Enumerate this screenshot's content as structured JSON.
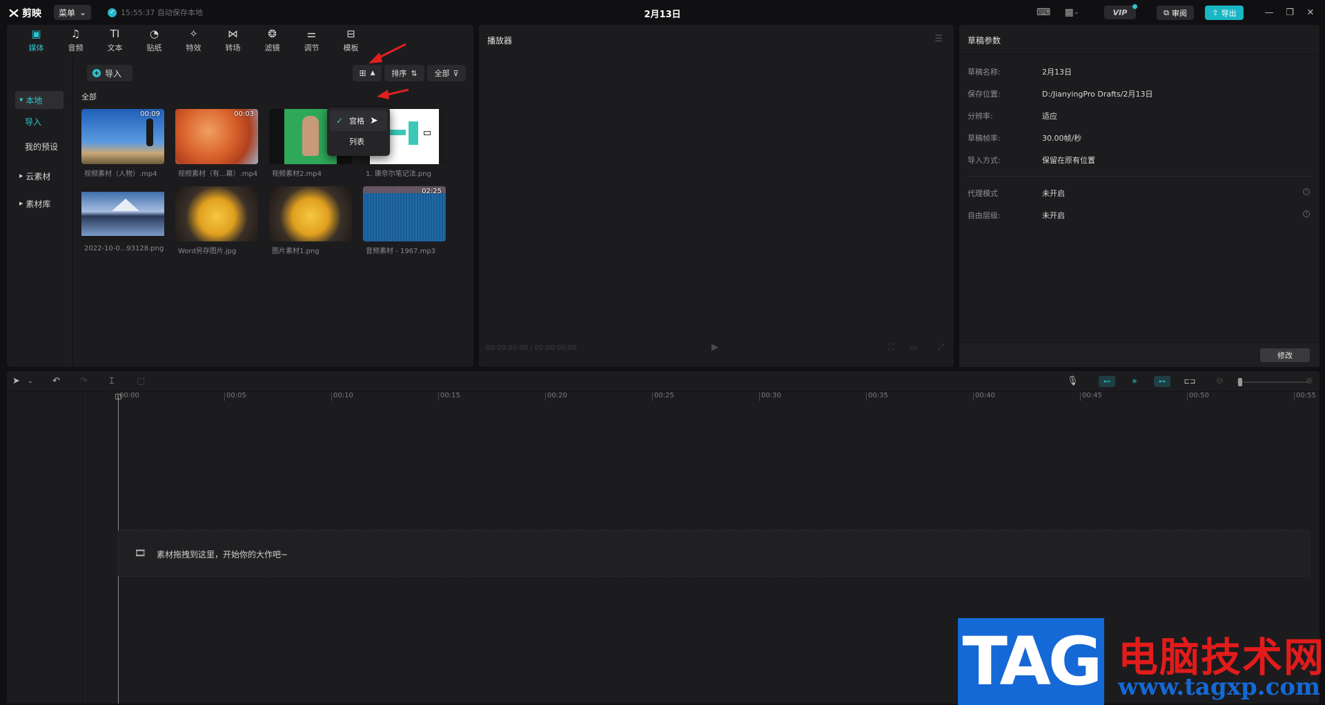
{
  "titlebar": {
    "app_name": "剪映",
    "menu_label": "菜单",
    "autosave_text": "15:55:37 自动保存本地",
    "doc_title": "2月13日",
    "vip_label": "VIP",
    "review_label": "审阅",
    "export_label": "导出"
  },
  "media": {
    "tabs": [
      {
        "label": "媒体",
        "icon": "▣"
      },
      {
        "label": "音频",
        "icon": "♫"
      },
      {
        "label": "文本",
        "icon": "TI"
      },
      {
        "label": "贴纸",
        "icon": "◔"
      },
      {
        "label": "特效",
        "icon": "✧"
      },
      {
        "label": "转场",
        "icon": "⋈"
      },
      {
        "label": "滤镜",
        "icon": "❂"
      },
      {
        "label": "调节",
        "icon": "⚌"
      },
      {
        "label": "模板",
        "icon": "⊟"
      }
    ],
    "sidebar": {
      "local": "本地",
      "import": "导入",
      "my_presets": "我的预设",
      "cloud": "云素材",
      "library": "素材库"
    },
    "import_label": "导入",
    "sort_label": "排序",
    "filter_label": "全部",
    "all_label": "全部",
    "view_menu": [
      {
        "label": "宫格",
        "selected": true
      },
      {
        "label": "列表",
        "selected": false
      }
    ],
    "items": [
      {
        "caption": "视频素材（人物）.mp4",
        "duration": "00:09"
      },
      {
        "caption": "视频素材（有...幕）.mp4",
        "duration": "00:03"
      },
      {
        "caption": "视频素材2.mp4",
        "duration": ""
      },
      {
        "caption": "1. 康奈尔笔记法.png",
        "duration": ""
      },
      {
        "caption": "2022-10-0...93128.png",
        "duration": ""
      },
      {
        "caption": "Word另存图片.jpg",
        "duration": ""
      },
      {
        "caption": "图片素材1.png",
        "duration": ""
      },
      {
        "caption": "音频素材 - 1967.mp3",
        "duration": "02:25"
      }
    ]
  },
  "player": {
    "title": "播放器",
    "time": "00:00:00:00 / 00:00:00:00"
  },
  "params": {
    "title": "草稿参数",
    "rows": [
      {
        "key": "草稿名称:",
        "value": "2月13日"
      },
      {
        "key": "保存位置:",
        "value": "D:/JianyingPro Drafts/2月13日"
      },
      {
        "key": "分辨率:",
        "value": "适应"
      },
      {
        "key": "草稿帧率:",
        "value": "30.00帧/秒"
      },
      {
        "key": "导入方式:",
        "value": "保留在原有位置"
      },
      {
        "key": "代理模式",
        "value": "未开启"
      },
      {
        "key": "自由层级:",
        "value": "未开启"
      }
    ],
    "edit_label": "修改"
  },
  "timeline": {
    "ticks": [
      "00:00",
      "00:05",
      "00:10",
      "00:15",
      "00:20",
      "00:25",
      "00:30",
      "00:35",
      "00:40",
      "00:45",
      "00:50",
      "00:55"
    ],
    "drop_hint": "素材拖拽到这里，开始你的大作吧~"
  },
  "watermark": {
    "tag": "TAG",
    "site_name": "电脑技术网",
    "url": "www.tagxp.com"
  }
}
